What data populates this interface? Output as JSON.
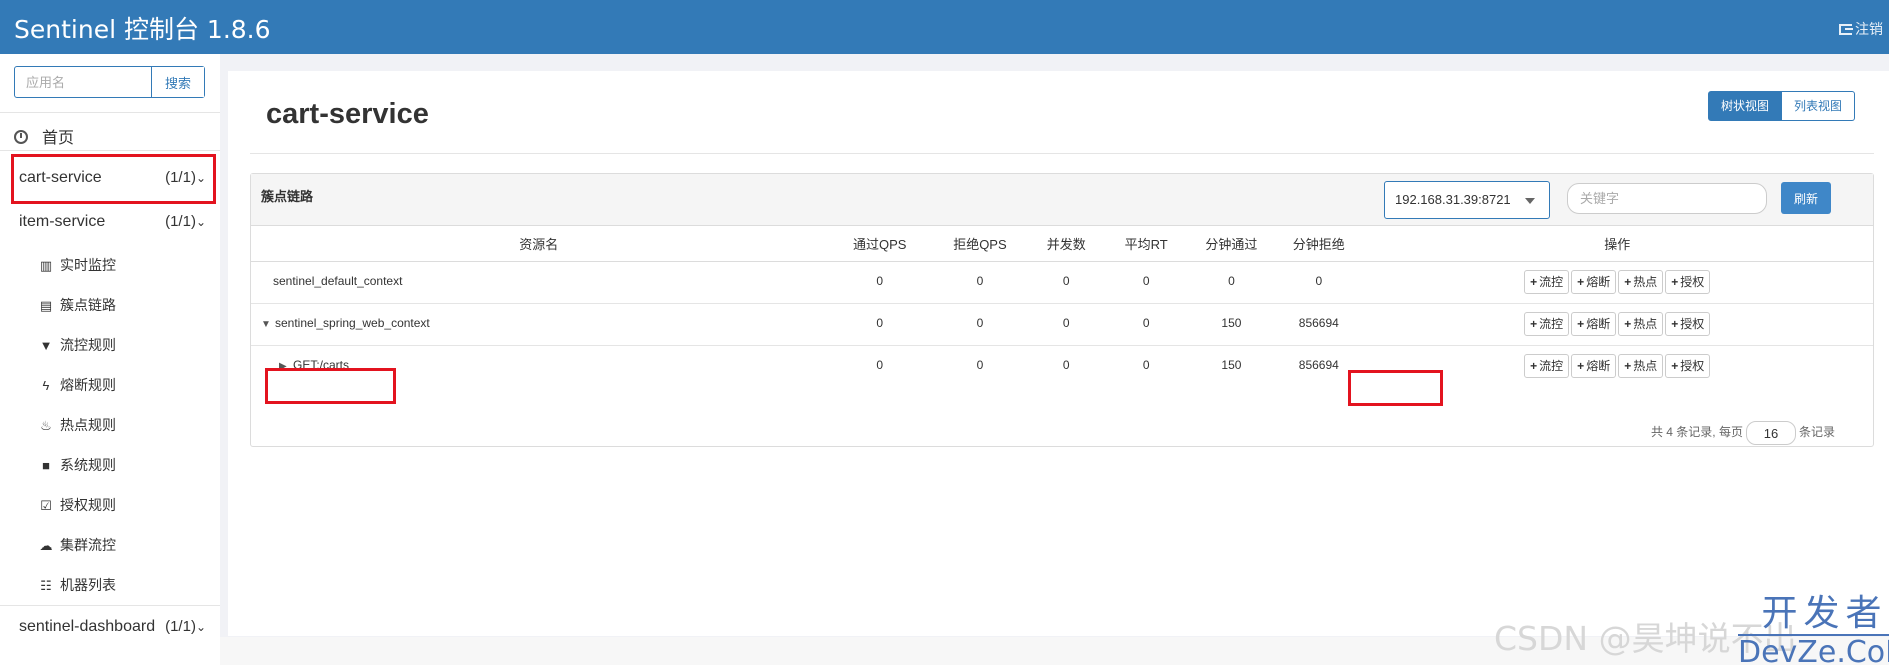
{
  "header": {
    "brand": "Sentinel 控制台 1.8.6",
    "logout": "注销"
  },
  "sidebar": {
    "search_placeholder": "应用名",
    "search_button": "搜索",
    "home": "首页",
    "apps": [
      {
        "name": "cart-service",
        "count": "(1/1)"
      },
      {
        "name": "item-service",
        "count": "(1/1)"
      },
      {
        "name": "sentinel-dashboard",
        "count": "(1/1)"
      }
    ],
    "menu": [
      {
        "label": "实时监控",
        "icon": "bar-chart-icon"
      },
      {
        "label": "簇点链路",
        "icon": "list-icon"
      },
      {
        "label": "流控规则",
        "icon": "filter-icon"
      },
      {
        "label": "熔断规则",
        "icon": "flash-icon"
      },
      {
        "label": "热点规则",
        "icon": "fire-icon"
      },
      {
        "label": "系统规则",
        "icon": "lock-icon"
      },
      {
        "label": "授权规则",
        "icon": "check-icon"
      },
      {
        "label": "集群流控",
        "icon": "cloud-icon"
      },
      {
        "label": "机器列表",
        "icon": "th-list-icon"
      }
    ]
  },
  "main": {
    "title": "cart-service",
    "views": [
      "树状视图",
      "列表视图"
    ],
    "panel": {
      "label": "簇点链路",
      "machine": "192.168.31.39:8721",
      "keyword_placeholder": "关键字",
      "refresh": "刷新"
    },
    "table": {
      "headers": [
        "资源名",
        "通过QPS",
        "拒绝QPS",
        "并发数",
        "平均RT",
        "分钟通过",
        "分钟拒绝",
        "操作"
      ],
      "rows": [
        {
          "toggle": "",
          "name": "sentinel_default_context",
          "pass_qps": "0",
          "block_qps": "0",
          "concurrency": "0",
          "avg_rt": "0",
          "min_pass": "0",
          "min_block": "0"
        },
        {
          "toggle": "▼",
          "name": "sentinel_spring_web_context",
          "pass_qps": "0",
          "block_qps": "0",
          "concurrency": "0",
          "avg_rt": "0",
          "min_pass": "150",
          "min_block": "856694"
        },
        {
          "toggle": "▶",
          "name": "GET:/carts",
          "pass_qps": "0",
          "block_qps": "0",
          "concurrency": "0",
          "avg_rt": "0",
          "min_pass": "150",
          "min_block": "856694"
        }
      ],
      "ops": [
        "流控",
        "熔断",
        "热点",
        "授权"
      ]
    },
    "pager": {
      "prefix": "共 4 条记录, 每页",
      "page_size": "16",
      "suffix": "条记录"
    }
  },
  "watermarks": {
    "csdn": "CSDN @昊坤说不出",
    "devze_top": "开发者",
    "devze_bottom": "DevZe.CoM"
  },
  "colors": {
    "header_bg": "#337ab7",
    "highlight_red": "#e3131f",
    "accent": "#337ab7"
  }
}
